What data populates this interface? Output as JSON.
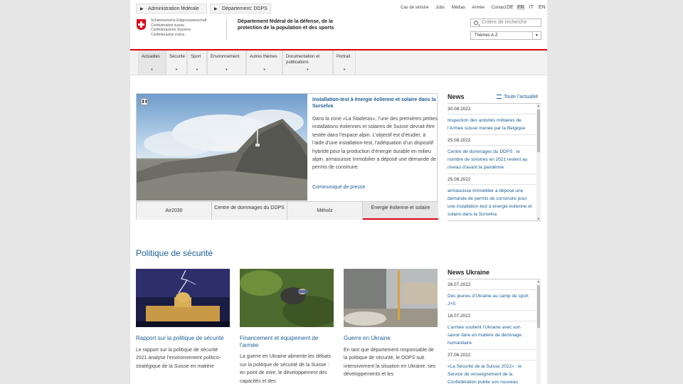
{
  "breadcrumbs": [
    "Administration fédérale",
    "Département: DDPS"
  ],
  "top_links": [
    "Cas de sinistre",
    "Jobs",
    "Médias",
    "Armée",
    "Contact"
  ],
  "languages": {
    "items": [
      "DE",
      "FR",
      "IT",
      "EN"
    ],
    "active": "FR"
  },
  "logo": {
    "lines": [
      "Schweizerische Eidgenossenschaft",
      "Confédération suisse",
      "Confederazione Svizzera",
      "Confederaziun svizra"
    ]
  },
  "department": "Département fédéral de la défense, de la protection de la population et des sports",
  "search": {
    "placeholder": "Critère de recherche"
  },
  "themes_select": "Thèmes A-Z",
  "nav": [
    "Actualités",
    "Sécurité",
    "Sport",
    "Environnement",
    "Autres thèmes",
    "Documentation et publications",
    "Portrait"
  ],
  "carousel": {
    "title": "Installation-test à énergie éolienne et solaire dans la Surselva",
    "body": "Dans la zone «La Staderas», l’une des premières petites installations éoliennes et solaires de Suisse devrait être testée dans l’espace alpin. L’objectif est d’étudier, à l’aide d’une installation-test, l’adéquation d’un dispositif hybride pour la production d’énergie durable en milieu alpin. armasuisse Immobilier a déposé une demande de permis de construire.",
    "link": "Communiqué de presse",
    "tabs": [
      "Air2030",
      "Centre de dommages du DDPS",
      "Mitholz",
      "Énergie éolienne et solaire"
    ],
    "active_tab": 3
  },
  "news": {
    "title": "News",
    "all_link": "Toute l’actualité",
    "items": [
      {
        "date": "30.08.2022",
        "text": "Inspection des activités militaires de l’Armée suisse menée par la Belgique"
      },
      {
        "date": "25.08.2022",
        "text": "Centre de dommages du DDPS : le nombre de sinistres en 2021 revient au niveau d’avant la pandémie"
      },
      {
        "date": "25.08.2022",
        "text": "armasuisse Immobilier a déposé une demande de permis de construire pour une installation-test à énergie éolienne et solaire dans la Surselva"
      }
    ]
  },
  "section": {
    "title": "Politique de sécurité",
    "cards": [
      {
        "title": "Rapport sur la politique de sécurité",
        "body": "Le rapport sur la politique de sécurité 2021 analyse l’environnement politico-stratégique de la Suisse en matière"
      },
      {
        "title": "Financement et équipement de l’armée",
        "body": "La guerre en Ukraine alimente les débats sur la politique de sécurité de la Suisse : en point de mire, le développement des capacités et des"
      },
      {
        "title": "Guerre en Ukraine",
        "body": "En tant que département responsable de la politique de sécurité, le DDPS suit intensivement la situation en Ukraine, ses développements et les"
      }
    ]
  },
  "news_ukraine": {
    "title": "News Ukraine",
    "items": [
      {
        "date": "28.07.2022",
        "text": "Des jeunes d’Ukraine au camp de sport J+S"
      },
      {
        "date": "18.07.2022",
        "text": "L’armée soutient l’Ukraine avec son savoir-faire en matière de déminage humanitaire"
      },
      {
        "date": "27.06.2022",
        "text": "«La Sécurité de la Suisse 2022» : le Service de renseignement de la Confédération publie son nouveau"
      }
    ]
  },
  "colors": {
    "accent_red": "#dc0018",
    "link_blue": "#1b5e96"
  }
}
